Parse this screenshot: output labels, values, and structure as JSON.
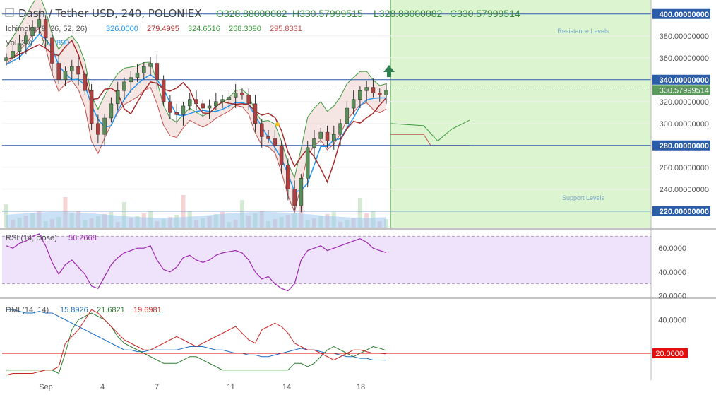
{
  "header": {
    "symbol": "Dash / Tether USD, 240, POLONIEX",
    "ohlc": [
      "O328.88000082",
      "H330.57999515",
      "L328.88000082",
      "C330.57999514"
    ],
    "ichimoku_label": "Ichimoku (9, 26, 52, 26)",
    "ichimoku_values": [
      "326.0000",
      "279.4995",
      "324.6516",
      "268.3090",
      "295.8331"
    ],
    "vol_label": "Vol (20)",
    "vol_values": [
      "71",
      "890"
    ]
  },
  "annotations": {
    "resistance": "Resistance Levels",
    "support": "Support Levels"
  },
  "colors": {
    "tenkan": "#2196f3",
    "kijun": "#a52a2a",
    "span_a": "#3c9a3c",
    "span_b": "#c0504d",
    "rsi": "#9c27b0",
    "dmi_plus": "#2e7d32",
    "dmi_minus": "#c62828",
    "adx": "#1e6fbf",
    "horizontal_line": "#2a5ca8",
    "bull": "#5a8f5a",
    "bear": "#b04040",
    "future_zone": "#dcf5d0",
    "arrow": "#2e7d4f"
  },
  "chart_data": [
    {
      "type": "candlestick",
      "title": "Dash / Tether USD, 240, POLONIEX",
      "ylim": [
        205,
        405
      ],
      "y_ticks": [
        "220.00000000",
        "240.00000000",
        "260.00000000",
        "280.00000000",
        "300.00000000",
        "320.00000000",
        "340.00000000",
        "360.00000000",
        "380.00000000",
        "400.00000000"
      ],
      "y_tick_values": [
        220,
        240,
        260,
        280,
        300,
        320,
        340,
        360,
        380,
        400
      ],
      "x_ticks": [
        "Sep",
        "4",
        "7",
        "11",
        "14",
        "18"
      ],
      "horizontal_lines": [
        400,
        340,
        280,
        220
      ],
      "current_price": "330.57999514",
      "close_prices": [
        360,
        366,
        373,
        380,
        388,
        395,
        378,
        355,
        340,
        348,
        352,
        345,
        330,
        300,
        290,
        305,
        318,
        330,
        338,
        342,
        346,
        352,
        355,
        340,
        320,
        310,
        308,
        316,
        322,
        318,
        314,
        316,
        320,
        322,
        324,
        328,
        326,
        318,
        300,
        288,
        286,
        280,
        262,
        240,
        225,
        250,
        278,
        286,
        292,
        284,
        290,
        300,
        314,
        322,
        330,
        333,
        328,
        326,
        330.58
      ]
    },
    {
      "type": "line",
      "title": "RSI (14, close)",
      "value": "56.2668",
      "y_ticks": [
        "20.0000",
        "40.0000",
        "60.0000"
      ],
      "y_tick_values": [
        20,
        40,
        60
      ],
      "ylim": [
        19,
        75
      ],
      "band": [
        30,
        70
      ],
      "values": [
        62,
        60,
        64,
        66,
        70,
        72,
        62,
        48,
        38,
        46,
        50,
        44,
        38,
        28,
        26,
        36,
        46,
        52,
        56,
        58,
        60,
        60,
        62,
        50,
        42,
        40,
        44,
        52,
        54,
        50,
        48,
        50,
        54,
        56,
        57,
        58,
        56,
        50,
        40,
        34,
        36,
        30,
        26,
        24,
        30,
        50,
        58,
        60,
        62,
        58,
        60,
        62,
        64,
        66,
        68,
        65,
        60,
        58,
        56.27
      ]
    },
    {
      "type": "line",
      "title": "DMI (14, 14)",
      "values_label": [
        "15.8926",
        "21.6821",
        "19.6981"
      ],
      "y_ticks": [
        "40.0000",
        "20.0000"
      ],
      "y_tick_values": [
        40,
        20
      ],
      "ylim": [
        4,
        52
      ],
      "reference_line": "20.0000",
      "reference_value": 20,
      "series": [
        {
          "values": [
            46,
            46,
            45,
            44,
            44,
            45,
            44,
            44,
            42,
            40,
            38,
            36,
            34,
            32,
            30,
            28,
            26,
            24,
            22,
            22,
            21,
            21,
            22,
            22,
            22,
            22,
            22,
            23,
            24,
            24,
            24,
            23,
            22,
            22,
            21,
            20,
            20,
            19,
            19,
            18,
            18,
            19,
            20,
            21,
            22,
            23,
            22,
            22,
            21,
            20,
            20,
            19,
            18,
            18,
            17,
            17,
            16,
            16,
            15.89
          ]
        },
        {
          "values": [
            10,
            10,
            10,
            10,
            10,
            10,
            10,
            10,
            8,
            20,
            34,
            40,
            42,
            44,
            42,
            40,
            36,
            30,
            26,
            24,
            22,
            20,
            18,
            16,
            14,
            14,
            14,
            16,
            18,
            18,
            16,
            14,
            12,
            10,
            10,
            10,
            10,
            10,
            10,
            10,
            10,
            10,
            10,
            10,
            14,
            14,
            12,
            14,
            18,
            22,
            24,
            22,
            20,
            18,
            20,
            22,
            24,
            23,
            21.68
          ]
        },
        {
          "values": [
            7,
            8,
            8,
            8,
            8,
            9,
            10,
            10,
            12,
            26,
            30,
            34,
            40,
            46,
            44,
            40,
            36,
            32,
            28,
            26,
            24,
            22,
            22,
            24,
            26,
            28,
            30,
            28,
            26,
            24,
            26,
            28,
            30,
            32,
            34,
            36,
            32,
            28,
            26,
            34,
            36,
            38,
            36,
            32,
            26,
            24,
            22,
            22,
            20,
            18,
            16,
            18,
            20,
            22,
            22,
            21,
            20,
            20,
            19.7
          ]
        }
      ]
    }
  ]
}
